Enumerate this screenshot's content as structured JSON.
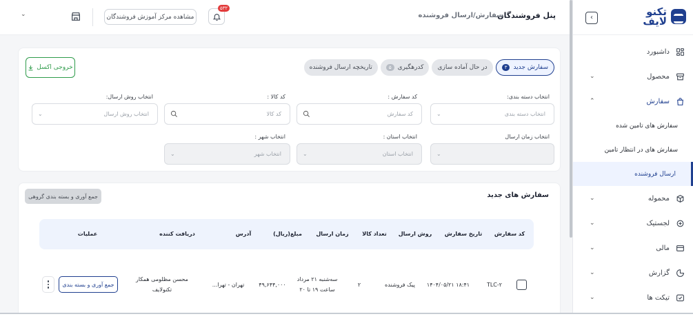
{
  "sidebar": {
    "logo_line1": "تکنو",
    "logo_line2": "لایف",
    "collapse_glyph": "›",
    "items": [
      {
        "label": "داشبورد",
        "icon": "dashboard-icon"
      },
      {
        "label": "محصول",
        "icon": "product-icon",
        "expandable": true
      },
      {
        "label": "سفارش",
        "icon": "order-bag-icon",
        "expanded": true
      },
      {
        "label": "محموله",
        "icon": "box-icon",
        "expandable": true
      },
      {
        "label": "لجستیک",
        "icon": "logistics-icon",
        "expandable": true
      },
      {
        "label": "مالی",
        "icon": "wallet-icon",
        "expandable": true
      },
      {
        "label": "گزارش",
        "icon": "report-icon",
        "expandable": true
      },
      {
        "label": "تیکت ها",
        "icon": "ticket-icon",
        "expandable": true
      }
    ],
    "order_sub_items": [
      "سفارش های تامین شده",
      "سفارش های در انتظار تامین",
      "ارسال فروشنده"
    ],
    "selected_sub_item": "ارسال فروشنده",
    "accent_color": "#1f3f8f"
  },
  "topbar": {
    "panel_title": "پنل فروشندگان",
    "breadcrumb": "سفارش/ارسال فروشنده",
    "notification_count": "۵۳۲",
    "education_button": "مشاهده مرکز آموزش فروشندگان"
  },
  "filters": {
    "tabs": [
      {
        "label": "سفارش جدید",
        "badge": "۳",
        "active": true
      },
      {
        "label": "در حال آماده سازی"
      },
      {
        "label": "کدرهگیری",
        "badge": "۵"
      },
      {
        "label": "تاریخچه ارسال فروشنده"
      }
    ],
    "excel_button": "خروجی اکسل",
    "row1": [
      {
        "label": "انتخاب دسته بندی:",
        "placeholder": "انتخاب دسته بندی"
      },
      {
        "label": "کد سفارش :",
        "placeholder": "کد سفارش"
      },
      {
        "label": "کد کالا :",
        "placeholder": "کد کالا"
      },
      {
        "label": "انتخاب روش ارسال:",
        "placeholder": "انتخاب روش ارسال"
      }
    ],
    "row2": [
      {
        "label": "انتخاب زمان ارسال",
        "placeholder": ""
      },
      {
        "label": "انتخاب استان :",
        "placeholder": "انتخاب استان"
      },
      {
        "label": "انتخاب شهر :",
        "placeholder": "انتخاب شهر"
      }
    ]
  },
  "orders": {
    "title": "سفارش های جدید",
    "group_button": "جمع آوری و بسته بندی گروهی",
    "columns": [
      "کد سفارش",
      "تاریخ سفارش",
      "روش ارسال",
      "تعداد کالا",
      "زمان ارسال",
      "مبلغ(ریال)",
      "آدرس",
      "دریافت کننده",
      "عملیات"
    ],
    "rows": [
      {
        "code": "TLC-۲",
        "date": "۱۸:۴۱ ۱۴۰۴/۰۵/۲۱",
        "method": "پیک فروشنده",
        "qty": "۲",
        "time1": "سه‌شنبه ۲۱ مرداد",
        "time2": "ساعت ۱۹ تا ۲۰",
        "amount": "۴۹,۶۴۴,۰۰۰",
        "address": "تهران - تهرا...",
        "receiver1": "محسن مظلومی همکار",
        "receiver2": "تکنولایف",
        "action": "جمع آوری و بسته بندی"
      }
    ]
  }
}
